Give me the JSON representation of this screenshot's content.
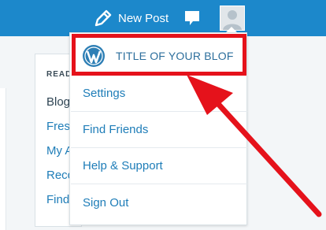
{
  "topbar": {
    "new_post_label": "New Post"
  },
  "reader": {
    "heading": "READ",
    "items": [
      "Blogs",
      "Fresh",
      "My A",
      "Reco",
      "Find"
    ]
  },
  "menu": {
    "blog_title": "TITLE OF YOUR BLOF",
    "items": [
      "Settings",
      "Find Friends",
      "Help & Support",
      "Sign Out"
    ]
  },
  "colors": {
    "topbar": "#1c88cb",
    "menu_link": "#1e7db8",
    "highlight": "#e5121b",
    "wp_logo": "#2e7fb5"
  }
}
